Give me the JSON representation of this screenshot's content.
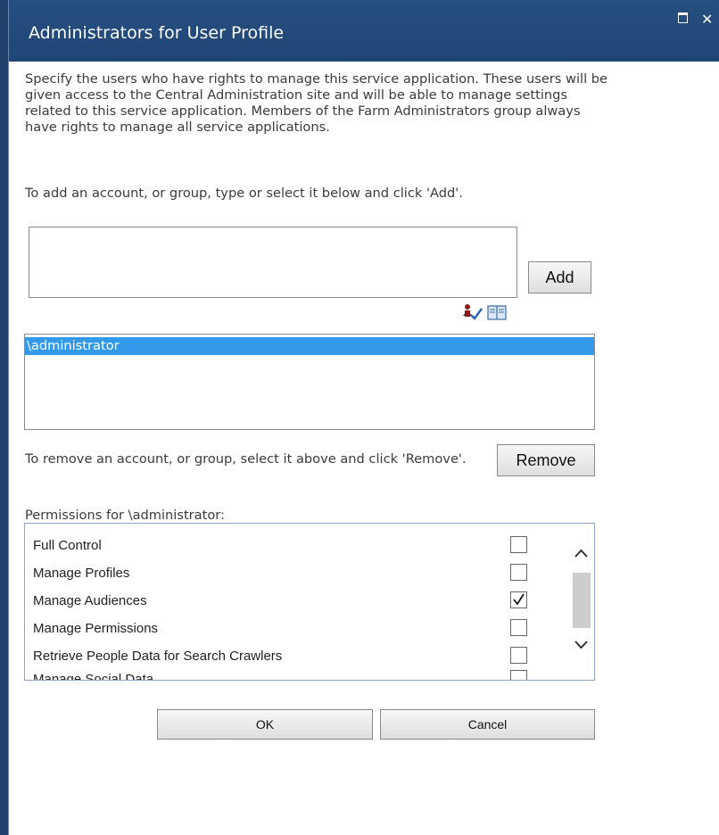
{
  "dialog": {
    "title": "Administrators for User Profile"
  },
  "description": "Specify the users who have rights to manage this service application. These users will be given access to the Central Administration site and will be able to manage settings related to this service application. Members of the Farm Administrators group always have rights to manage all service applications.",
  "add_section": {
    "instruction": "To add an account, or group, type or select it below and click 'Add'.",
    "input_value": "",
    "add_label": "Add"
  },
  "admins": {
    "items": [
      "\\administrator"
    ]
  },
  "remove_section": {
    "instruction": "To remove an account, or group, select it above and click 'Remove'.",
    "remove_label": "Remove"
  },
  "permissions": {
    "label": "Permissions for \\administrator:",
    "items": [
      {
        "name": "Full Control",
        "checked": false
      },
      {
        "name": "Manage Profiles",
        "checked": false
      },
      {
        "name": "Manage Audiences",
        "checked": true
      },
      {
        "name": "Manage Permissions",
        "checked": false
      },
      {
        "name": "Retrieve People Data for Search Crawlers",
        "checked": false
      },
      {
        "name": "Manage Social Data",
        "checked": false
      }
    ]
  },
  "footer": {
    "ok_label": "OK",
    "cancel_label": "Cancel"
  },
  "colors": {
    "titlebar": "#264f81",
    "selection": "#3399ea"
  }
}
